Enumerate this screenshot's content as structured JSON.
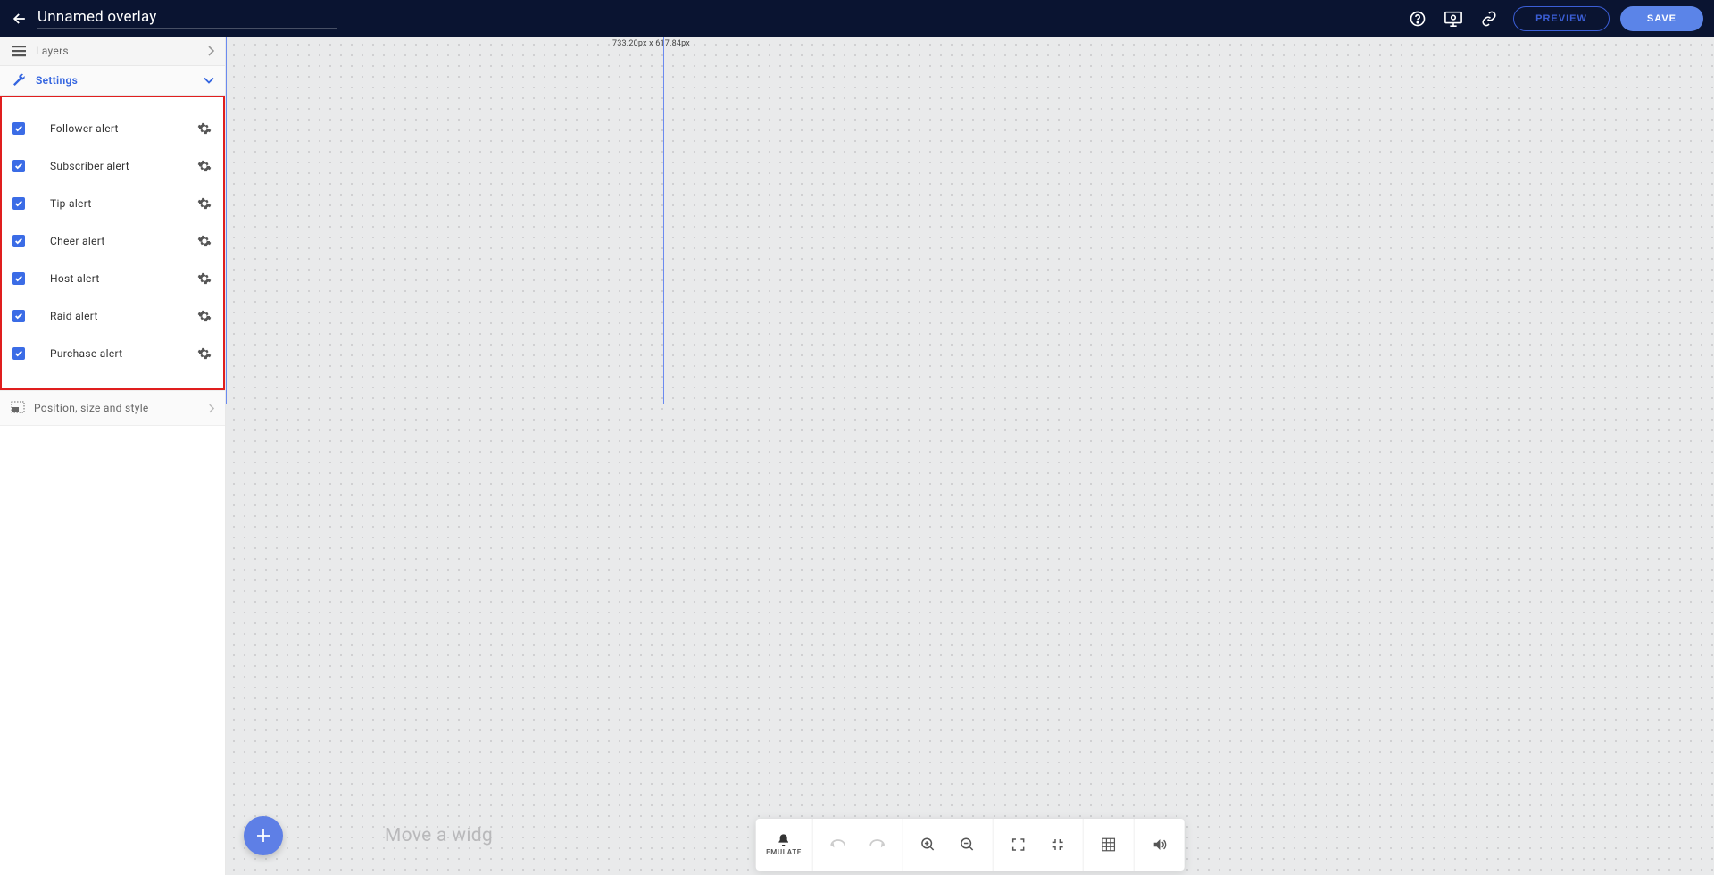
{
  "header": {
    "title": "Unnamed overlay",
    "preview_label": "PREVIEW",
    "save_label": "SAVE"
  },
  "sidebar": {
    "layers_label": "Layers",
    "settings_label": "Settings",
    "alerts": [
      {
        "label": "Follower alert",
        "checked": true
      },
      {
        "label": "Subscriber alert",
        "checked": true
      },
      {
        "label": "Tip alert",
        "checked": true
      },
      {
        "label": "Cheer alert",
        "checked": true
      },
      {
        "label": "Host alert",
        "checked": true
      },
      {
        "label": "Raid alert",
        "checked": true
      },
      {
        "label": "Purchase alert",
        "checked": true
      }
    ],
    "position_label": "Position, size and style"
  },
  "canvas": {
    "size_label": "733.20px x 617.84px",
    "hint_text": "Move a widg"
  },
  "toolbar": {
    "emulate_label": "EMULATE"
  }
}
